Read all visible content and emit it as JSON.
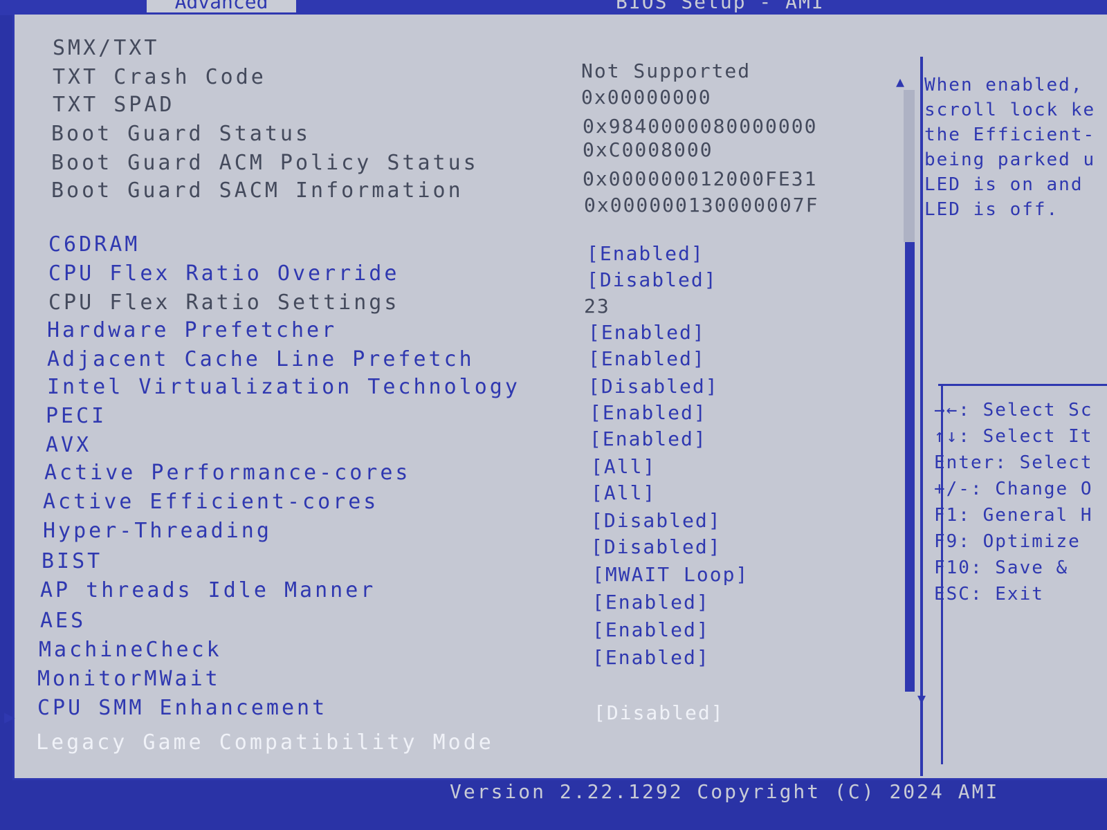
{
  "header": {
    "tab_label": "Advanced",
    "title": "BIOS Setup - AMI"
  },
  "settings": [
    {
      "label": "SMX/TXT",
      "value": "",
      "label_color": "gray",
      "value_color": "gray"
    },
    {
      "label": "TXT Crash Code",
      "value": "Not Supported",
      "label_color": "gray",
      "value_color": "gray"
    },
    {
      "label": "TXT SPAD",
      "value": "0x00000000",
      "label_color": "gray",
      "value_color": "gray"
    },
    {
      "label": "Boot Guard Status",
      "value": "0x9840000080000000",
      "label_color": "gray",
      "value_color": "gray"
    },
    {
      "label": "Boot Guard ACM Policy Status",
      "value": "0xC0008000",
      "label_color": "gray",
      "value_color": "gray"
    },
    {
      "label": "Boot Guard SACM Information",
      "value": "0x000000012000FE31",
      "label_color": "gray",
      "value_color": "gray"
    },
    {
      "label": "",
      "value": "0x000000130000007F",
      "label_color": "gray",
      "value_color": "gray"
    },
    {
      "label": "C6DRAM",
      "value": "[Enabled]",
      "label_color": "blue",
      "value_color": "blue"
    },
    {
      "label": "CPU Flex Ratio Override",
      "value": "[Disabled]",
      "label_color": "blue",
      "value_color": "blue"
    },
    {
      "label": "CPU Flex Ratio Settings",
      "value": "23",
      "label_color": "gray",
      "value_color": "gray"
    },
    {
      "label": "Hardware Prefetcher",
      "value": "[Enabled]",
      "label_color": "blue",
      "value_color": "blue"
    },
    {
      "label": "Adjacent Cache Line Prefetch",
      "value": "[Enabled]",
      "label_color": "blue",
      "value_color": "blue"
    },
    {
      "label": "Intel Virtualization Technology",
      "value": "[Disabled]",
      "label_color": "blue",
      "value_color": "blue"
    },
    {
      "label": "PECI",
      "value": "[Enabled]",
      "label_color": "blue",
      "value_color": "blue"
    },
    {
      "label": "AVX",
      "value": "[Enabled]",
      "label_color": "blue",
      "value_color": "blue"
    },
    {
      "label": "Active Performance-cores",
      "value": "[All]",
      "label_color": "blue",
      "value_color": "blue"
    },
    {
      "label": "Active Efficient-cores",
      "value": "[All]",
      "label_color": "blue",
      "value_color": "blue"
    },
    {
      "label": "Hyper-Threading",
      "value": "[Disabled]",
      "label_color": "blue",
      "value_color": "blue"
    },
    {
      "label": "BIST",
      "value": "[Disabled]",
      "label_color": "blue",
      "value_color": "blue"
    },
    {
      "label": "AP threads Idle Manner",
      "value": "[MWAIT Loop]",
      "label_color": "blue",
      "value_color": "blue"
    },
    {
      "label": "AES",
      "value": "[Enabled]",
      "label_color": "blue",
      "value_color": "blue"
    },
    {
      "label": "MachineCheck",
      "value": "[Enabled]",
      "label_color": "blue",
      "value_color": "blue"
    },
    {
      "label": "MonitorMWait",
      "value": "[Enabled]",
      "label_color": "blue",
      "value_color": "blue"
    },
    {
      "label": "CPU SMM Enhancement",
      "value": "",
      "label_color": "blue",
      "value_color": "blue"
    },
    {
      "label": "Legacy Game Compatibility Mode",
      "value": "[Disabled]",
      "label_color": "white",
      "value_color": "white"
    }
  ],
  "help": {
    "lines": [
      "When enabled,",
      "scroll lock ke",
      "the Efficient-",
      "being parked u",
      "LED is on and",
      "LED is off."
    ]
  },
  "keys": [
    "→←: Select Sc",
    "↑↓: Select It",
    "Enter: Select",
    "+/-: Change O",
    "F1: General H",
    "F9: Optimize",
    "F10: Save &",
    "ESC: Exit"
  ],
  "footer": {
    "version": "Version 2.22.1292 Copyright (C) 2024 AMI"
  }
}
